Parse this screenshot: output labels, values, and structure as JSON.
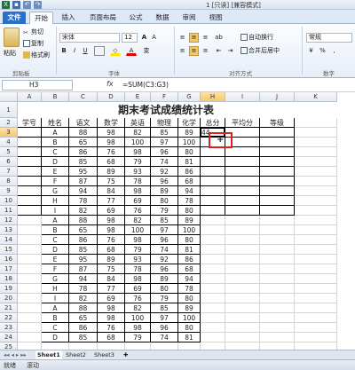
{
  "window": {
    "title": "1 [只读] [兼容模式]"
  },
  "tabs": [
    {
      "label": "文件"
    },
    {
      "label": "开始"
    },
    {
      "label": "插入"
    },
    {
      "label": "页面布局"
    },
    {
      "label": "公式"
    },
    {
      "label": "数据"
    },
    {
      "label": "审阅"
    },
    {
      "label": "视图"
    }
  ],
  "ribbon": {
    "paste_label": "粘贴",
    "cut_label": "剪切",
    "copy_label": "复制",
    "format_painter_label": "格式刷",
    "clipboard_group": "剪贴板",
    "font_name": "宋体",
    "font_size": "12",
    "font_group": "字体",
    "align_group": "对齐方式",
    "wrap_label": "自动换行",
    "merge_label": "合并后居中",
    "number_format": "常规",
    "number_group": "数字",
    "bold": "B",
    "italic": "I",
    "underline": "U"
  },
  "formula_bar": {
    "name_box": "H3",
    "fx": "fx",
    "formula": "=SUM(C3:G3)"
  },
  "columns": [
    "A",
    "B",
    "C",
    "D",
    "E",
    "F",
    "G",
    "H",
    "I",
    "J",
    "K"
  ],
  "rows": [
    "1",
    "2",
    "3",
    "4",
    "5",
    "6",
    "7",
    "8",
    "9",
    "10",
    "11",
    "12",
    "13",
    "14",
    "15",
    "16",
    "17",
    "18",
    "19",
    "20",
    "21",
    "22",
    "23",
    "24",
    "25",
    "26"
  ],
  "sheet_title": "期末考试成绩统计表",
  "headers": [
    "学号",
    "姓名",
    "语文",
    "数学",
    "英语",
    "物理",
    "化学",
    "总分",
    "平均分",
    "等级"
  ],
  "data_rows": [
    [
      "A",
      "88",
      "98",
      "82",
      "85",
      "89"
    ],
    [
      "B",
      "65",
      "98",
      "100",
      "97",
      "100"
    ],
    [
      "C",
      "86",
      "76",
      "98",
      "96",
      "80"
    ],
    [
      "D",
      "85",
      "68",
      "79",
      "74",
      "81"
    ],
    [
      "E",
      "95",
      "89",
      "93",
      "92",
      "86"
    ],
    [
      "F",
      "87",
      "75",
      "78",
      "96",
      "68"
    ],
    [
      "G",
      "94",
      "84",
      "98",
      "89",
      "94"
    ],
    [
      "H",
      "78",
      "77",
      "69",
      "80",
      "78"
    ],
    [
      "I",
      "82",
      "69",
      "76",
      "79",
      "80"
    ],
    [
      "A",
      "88",
      "98",
      "82",
      "85",
      "89"
    ],
    [
      "B",
      "65",
      "98",
      "100",
      "97",
      "100"
    ],
    [
      "C",
      "86",
      "76",
      "98",
      "96",
      "80"
    ],
    [
      "D",
      "85",
      "68",
      "79",
      "74",
      "81"
    ],
    [
      "E",
      "95",
      "89",
      "93",
      "92",
      "86"
    ],
    [
      "F",
      "87",
      "75",
      "78",
      "96",
      "68"
    ],
    [
      "G",
      "94",
      "84",
      "98",
      "89",
      "94"
    ],
    [
      "H",
      "78",
      "77",
      "69",
      "80",
      "78"
    ],
    [
      "I",
      "82",
      "69",
      "76",
      "79",
      "80"
    ],
    [
      "A",
      "88",
      "98",
      "82",
      "85",
      "89"
    ],
    [
      "B",
      "65",
      "98",
      "100",
      "97",
      "100"
    ],
    [
      "C",
      "86",
      "76",
      "98",
      "96",
      "80"
    ],
    [
      "D",
      "85",
      "68",
      "79",
      "74",
      "81"
    ]
  ],
  "h3_value": "44",
  "sheets": [
    "Sheet1",
    "Sheet2",
    "Sheet3"
  ],
  "status": {
    "ready": "就绪",
    "scroll": "滚动"
  }
}
